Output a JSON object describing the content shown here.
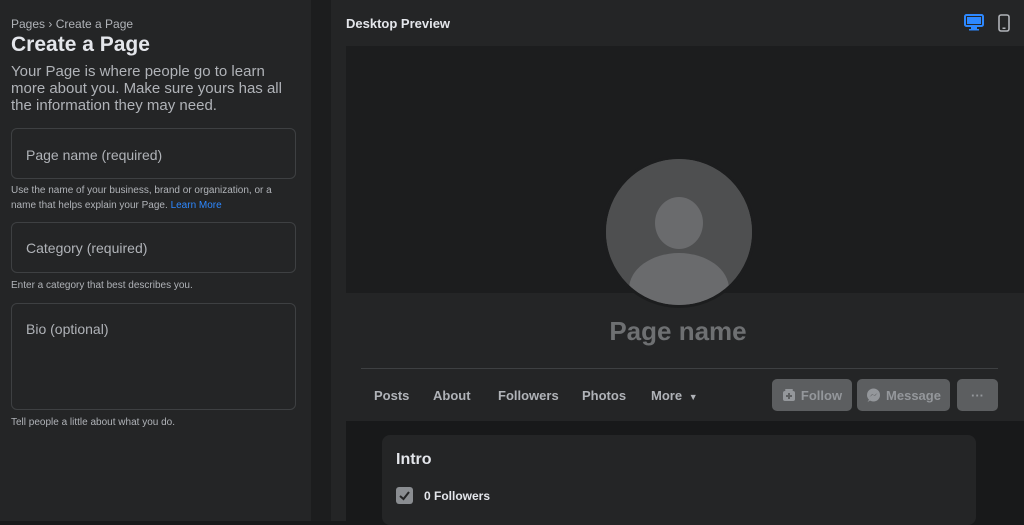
{
  "form": {
    "breadcrumb": "Pages › Create a Page",
    "title": "Create a Page",
    "intro": "Your Page is where people go to learn more about you. Make sure yours has all the information they may need.",
    "page_name_placeholder": "Page name (required)",
    "page_name_help": "Use the name of your business, brand or organization, or a name that helps explain your Page.",
    "learn_more": "Learn More",
    "category_placeholder": "Category (required)",
    "category_help": "Enter a category that best describes you.",
    "bio_placeholder": "Bio (optional)",
    "bio_help": "Tell people a little about what you do."
  },
  "preview": {
    "header": "Desktop Preview",
    "page_name": "Page name",
    "tabs": [
      "Posts",
      "About",
      "Followers",
      "Photos",
      "More"
    ],
    "follow_label": "Follow",
    "message_label": "Message",
    "more_options_label": "···",
    "intro_title": "Intro",
    "followers_text": "0 Followers"
  },
  "icons": {
    "desktop": "desktop-icon",
    "mobile": "mobile-icon",
    "follow": "follow-icon",
    "messenger": "messenger-icon",
    "followers": "followers-icon"
  },
  "colors": {
    "accent": "#2d88ff",
    "panel": "#242526",
    "background": "#18191a"
  }
}
